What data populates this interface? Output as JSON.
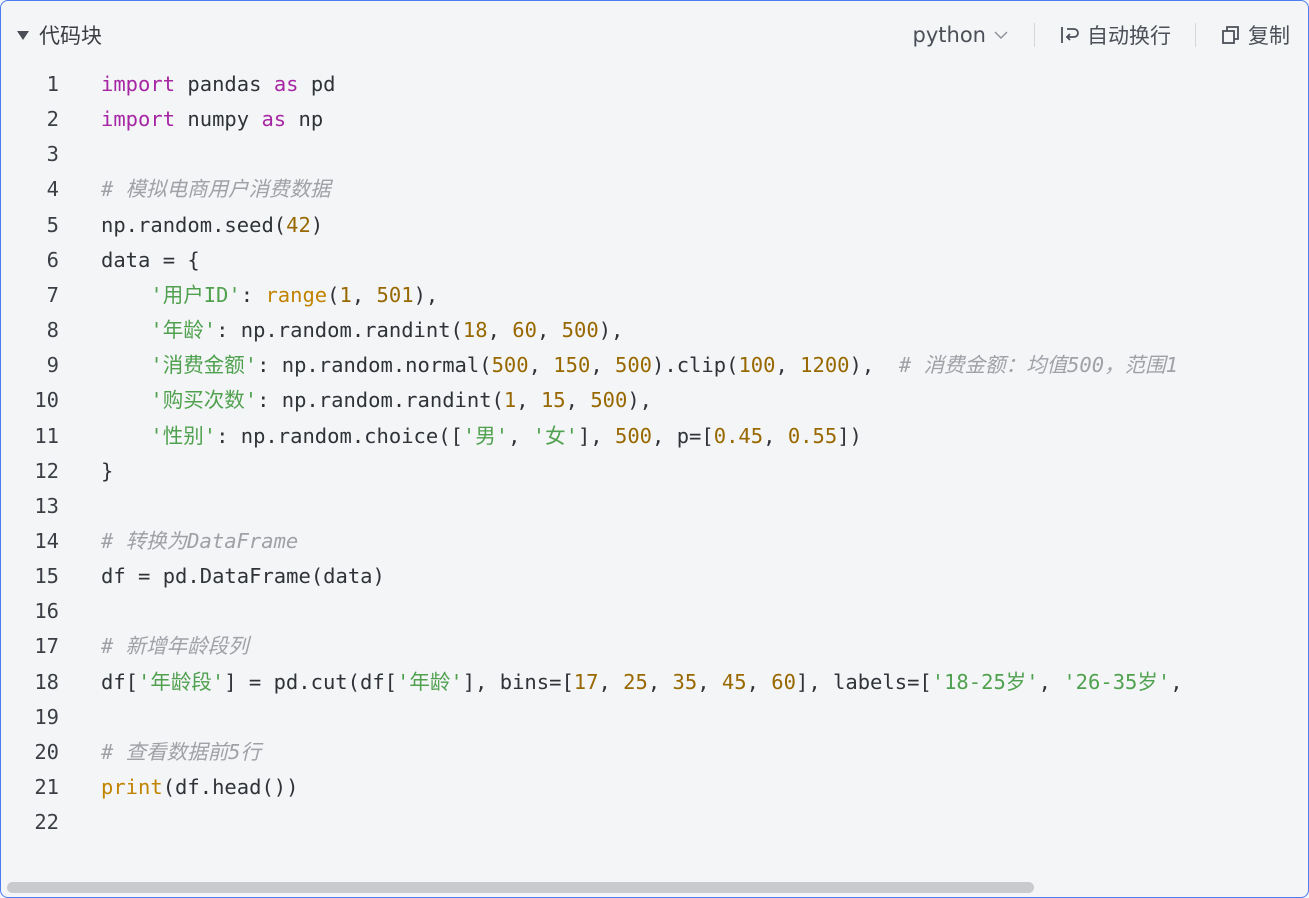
{
  "header": {
    "title": "代码块",
    "language": "python",
    "wrap_label": "自动换行",
    "copy_label": "复制"
  },
  "icons": [
    "collapse-triangle-icon",
    "chevron-down-icon",
    "wrap-icon",
    "copy-icon"
  ],
  "colors": {
    "keyword": "#a626a4",
    "builtin": "#c18401",
    "number": "#986801",
    "string": "#50a14f",
    "comment": "#a0a1a7",
    "border": "#4e7cf3"
  },
  "code_lines": [
    [
      [
        "kw",
        "import"
      ],
      [
        "p",
        " pandas "
      ],
      [
        "kw",
        "as"
      ],
      [
        "p",
        " pd"
      ]
    ],
    [
      [
        "kw",
        "import"
      ],
      [
        "p",
        " numpy "
      ],
      [
        "kw",
        "as"
      ],
      [
        "p",
        " np"
      ]
    ],
    [],
    [
      [
        "com",
        "# 模拟电商用户消费数据"
      ]
    ],
    [
      [
        "p",
        "np.random.seed("
      ],
      [
        "num",
        "42"
      ],
      [
        "p",
        ")"
      ]
    ],
    [
      [
        "p",
        "data = {"
      ]
    ],
    [
      [
        "p",
        "    "
      ],
      [
        "str",
        "'用户ID'"
      ],
      [
        "p",
        ": "
      ],
      [
        "bi",
        "range"
      ],
      [
        "p",
        "("
      ],
      [
        "num",
        "1"
      ],
      [
        "p",
        ", "
      ],
      [
        "num",
        "501"
      ],
      [
        "p",
        "),"
      ]
    ],
    [
      [
        "p",
        "    "
      ],
      [
        "str",
        "'年龄'"
      ],
      [
        "p",
        ": np.random.randint("
      ],
      [
        "num",
        "18"
      ],
      [
        "p",
        ", "
      ],
      [
        "num",
        "60"
      ],
      [
        "p",
        ", "
      ],
      [
        "num",
        "500"
      ],
      [
        "p",
        "),"
      ]
    ],
    [
      [
        "p",
        "    "
      ],
      [
        "str",
        "'消费金额'"
      ],
      [
        "p",
        ": np.random.normal("
      ],
      [
        "num",
        "500"
      ],
      [
        "p",
        ", "
      ],
      [
        "num",
        "150"
      ],
      [
        "p",
        ", "
      ],
      [
        "num",
        "500"
      ],
      [
        "p",
        ").clip("
      ],
      [
        "num",
        "100"
      ],
      [
        "p",
        ", "
      ],
      [
        "num",
        "1200"
      ],
      [
        "p",
        "),  "
      ],
      [
        "com",
        "# 消费金额：均值500，范围1"
      ]
    ],
    [
      [
        "p",
        "    "
      ],
      [
        "str",
        "'购买次数'"
      ],
      [
        "p",
        ": np.random.randint("
      ],
      [
        "num",
        "1"
      ],
      [
        "p",
        ", "
      ],
      [
        "num",
        "15"
      ],
      [
        "p",
        ", "
      ],
      [
        "num",
        "500"
      ],
      [
        "p",
        "),"
      ]
    ],
    [
      [
        "p",
        "    "
      ],
      [
        "str",
        "'性别'"
      ],
      [
        "p",
        ": np.random.choice(["
      ],
      [
        "str",
        "'男'"
      ],
      [
        "p",
        ", "
      ],
      [
        "str",
        "'女'"
      ],
      [
        "p",
        "], "
      ],
      [
        "num",
        "500"
      ],
      [
        "p",
        ", p=["
      ],
      [
        "num",
        "0.45"
      ],
      [
        "p",
        ", "
      ],
      [
        "num",
        "0.55"
      ],
      [
        "p",
        "])"
      ]
    ],
    [
      [
        "p",
        "}"
      ]
    ],
    [],
    [
      [
        "com",
        "# 转换为DataFrame"
      ]
    ],
    [
      [
        "p",
        "df = pd.DataFrame(data)"
      ]
    ],
    [],
    [
      [
        "com",
        "# 新增年龄段列"
      ]
    ],
    [
      [
        "p",
        "df["
      ],
      [
        "str",
        "'年龄段'"
      ],
      [
        "p",
        "] = pd.cut(df["
      ],
      [
        "str",
        "'年龄'"
      ],
      [
        "p",
        "], bins=["
      ],
      [
        "num",
        "17"
      ],
      [
        "p",
        ", "
      ],
      [
        "num",
        "25"
      ],
      [
        "p",
        ", "
      ],
      [
        "num",
        "35"
      ],
      [
        "p",
        ", "
      ],
      [
        "num",
        "45"
      ],
      [
        "p",
        ", "
      ],
      [
        "num",
        "60"
      ],
      [
        "p",
        "], labels=["
      ],
      [
        "str",
        "'18-25岁'"
      ],
      [
        "p",
        ", "
      ],
      [
        "str",
        "'26-35岁'"
      ],
      [
        "p",
        ","
      ]
    ],
    [],
    [
      [
        "com",
        "# 查看数据前5行"
      ]
    ],
    [
      [
        "bi",
        "print"
      ],
      [
        "p",
        "(df.head())"
      ]
    ],
    []
  ]
}
